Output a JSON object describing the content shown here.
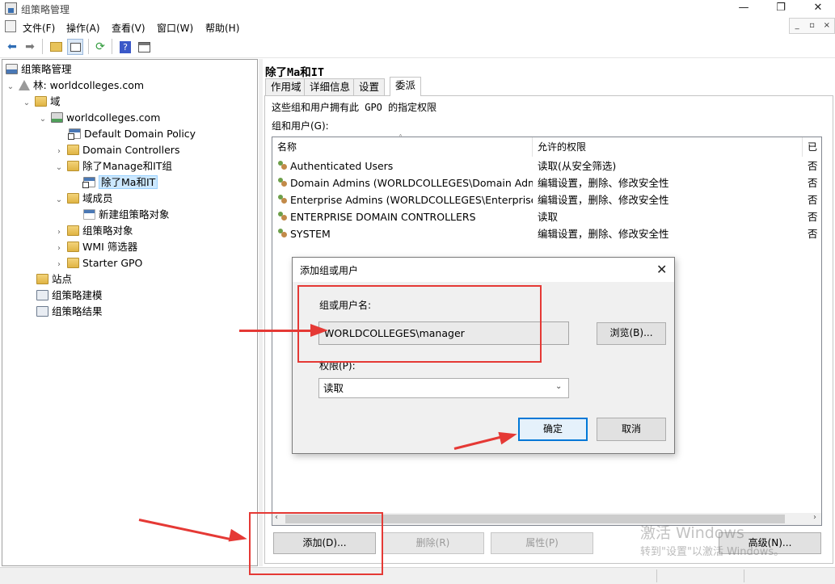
{
  "window": {
    "title": "组策略管理",
    "minimize": "—",
    "maximize": "❐",
    "close": "✕"
  },
  "menu": [
    "文件(F)",
    "操作(A)",
    "查看(V)",
    "窗口(W)",
    "帮助(H)"
  ],
  "mdi_buttons": [
    "_",
    "▫",
    "×"
  ],
  "toolbar_icons": [
    "back-icon",
    "forward-icon",
    "up-folder-icon",
    "show-tree-icon",
    "refresh-icon",
    "help-icon",
    "properties-icon"
  ],
  "tree": {
    "root": "组策略管理",
    "forest": "林: worldcolleges.com",
    "domains": "域",
    "domain": "worldcolleges.com",
    "default_policy": "Default Domain Policy",
    "domain_controllers": "Domain Controllers",
    "ou": "除了Manage和IT组",
    "ou_link": "除了Ma和IT",
    "members": "域成员",
    "new_gpo": "新建组策略对象",
    "gpo_objects": "组策略对象",
    "wmi": "WMI 筛选器",
    "starter": "Starter GPO",
    "sites": "站点",
    "modeling": "组策略建模",
    "results": "组策略结果"
  },
  "right": {
    "title": "除了Ma和IT",
    "tabs": [
      "作用域",
      "详细信息",
      "设置",
      "委派"
    ],
    "active_tab": "委派",
    "description": "这些组和用户拥有此 GPO 的指定权限",
    "group_label": "组和用户(G):",
    "columns": [
      "名称",
      "允许的权限",
      "已继"
    ],
    "rows": [
      {
        "name": "Authenticated Users",
        "perm": "读取(从安全筛选)",
        "inherited": "否"
      },
      {
        "name": "Domain Admins (WORLDCOLLEGES\\Domain Adm...",
        "perm": "编辑设置，删除、修改安全性",
        "inherited": "否"
      },
      {
        "name": "Enterprise Admins (WORLDCOLLEGES\\Enterprise ...",
        "perm": "编辑设置，删除、修改安全性",
        "inherited": "否"
      },
      {
        "name": "ENTERPRISE DOMAIN CONTROLLERS",
        "perm": "读取",
        "inherited": "否"
      },
      {
        "name": "SYSTEM",
        "perm": "编辑设置，删除、修改安全性",
        "inherited": "否"
      }
    ],
    "buttons": {
      "add": "添加(D)...",
      "remove": "删除(R)",
      "properties": "属性(P)",
      "advanced": "高级(N)..."
    }
  },
  "dialog": {
    "title": "添加组或用户",
    "user_label": "组或用户名:",
    "user_value": "WORLDCOLLEGES\\manager",
    "browse": "浏览(B)...",
    "perm_label": "权限(P):",
    "perm_value": "读取",
    "ok": "确定",
    "cancel": "取消"
  },
  "watermark": {
    "line1": "激活 Windows",
    "line2": "转到\"设置\"以激活 Windows。"
  },
  "colors": {
    "annotation_red": "#e53935",
    "selection": "#cce8ff",
    "accent": "#0078d7"
  }
}
